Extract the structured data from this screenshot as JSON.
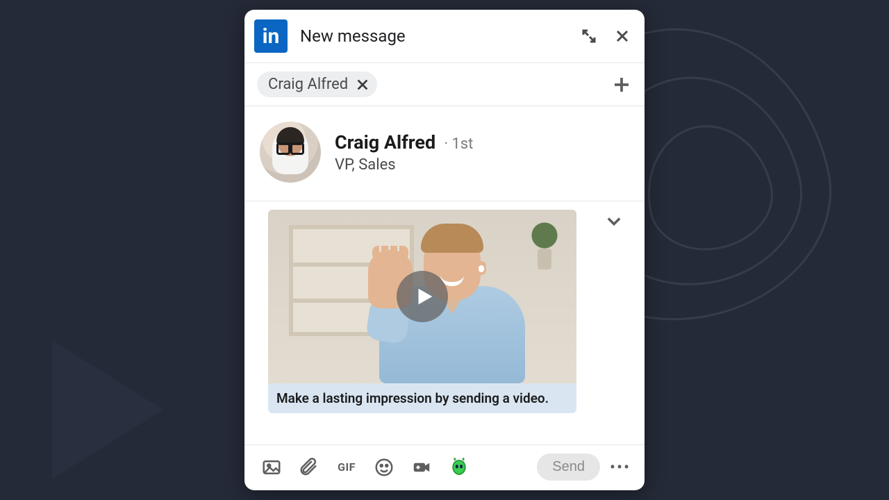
{
  "header": {
    "logo_text": "in",
    "title": "New message"
  },
  "recipient": {
    "chip_name": "Craig Alfred"
  },
  "contact": {
    "name": "Craig Alfred",
    "degree": "1st",
    "title": "VP, Sales"
  },
  "video": {
    "caption": "Make a lasting impression by sending a video."
  },
  "toolbar": {
    "gif_label": "GIF",
    "send_label": "Send"
  }
}
